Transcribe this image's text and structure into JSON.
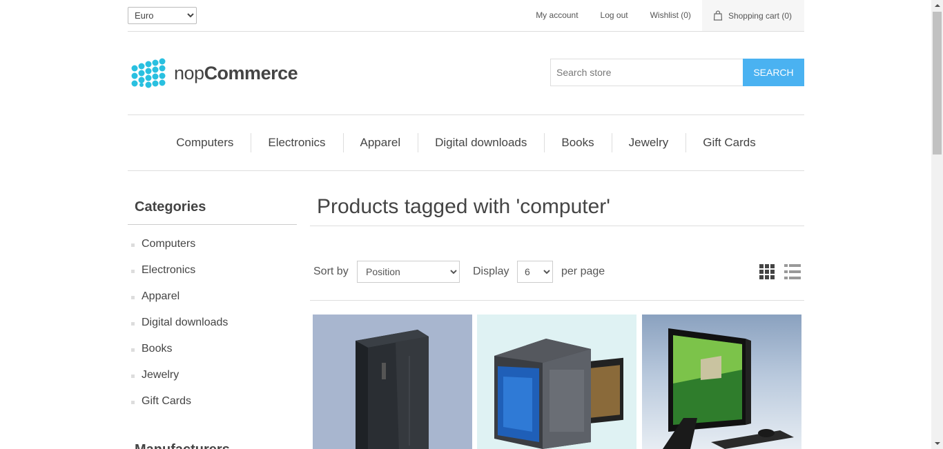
{
  "header": {
    "currency": {
      "selected": "Euro",
      "options": [
        "Euro"
      ]
    },
    "links": {
      "my_account": "My account",
      "log_out": "Log out",
      "wishlist": "Wishlist (0)",
      "shopping_cart": "Shopping cart (0)"
    }
  },
  "logo": {
    "part1": "nop",
    "part2": "Commerce"
  },
  "search": {
    "placeholder": "Search store",
    "button": "SEARCH"
  },
  "top_menu": [
    "Computers",
    "Electronics",
    "Apparel",
    "Digital downloads",
    "Books",
    "Jewelry",
    "Gift Cards"
  ],
  "sidebar": {
    "title": "Categories",
    "items": [
      "Computers",
      "Electronics",
      "Apparel",
      "Digital downloads",
      "Books",
      "Jewelry",
      "Gift Cards"
    ],
    "next_title": "Manufacturers"
  },
  "main": {
    "page_title": "Products tagged with 'computer'",
    "sort_label": "Sort by",
    "sort_selected": "Position",
    "display_label": "Display",
    "display_selected": "6",
    "per_page_label": "per page"
  },
  "products": [
    {
      "image": "server-tower-image"
    },
    {
      "image": "gaming-desktop-image"
    },
    {
      "image": "all-in-one-pc-image"
    }
  ],
  "colors": {
    "accent": "#4ab2f1",
    "logo": "#29c0e0"
  }
}
